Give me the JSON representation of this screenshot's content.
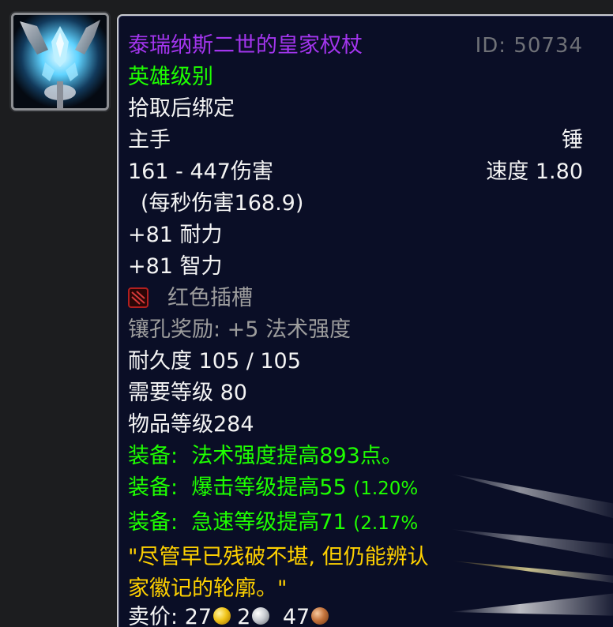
{
  "item": {
    "name": "泰瑞纳斯二世的皇家权杖",
    "id_text": "ID: 50734",
    "quality": "英雄级别",
    "bind": "拾取后绑定",
    "slot": "主手",
    "type": "锤",
    "damage": "161 - 447伤害",
    "speed": "速度 1.80",
    "dps": "(每秒伤害168.9)",
    "stat1": "+81 耐力",
    "stat2": "+81 智力",
    "socket_label": "红色插槽",
    "socket_bonus": "镶孔奖励: +5 法术强度",
    "durability": "耐久度 105 / 105",
    "req_level": "需要等级 80",
    "item_level": "物品等级284",
    "equip1_prefix": "装备:",
    "equip1_text": "法术强度提高893点。",
    "equip2_prefix": "装备:",
    "equip2_text": "爆击等级提高55",
    "equip2_pct": "(1.20%",
    "equip3_prefix": "装备:",
    "equip3_text": "急速等级提高71",
    "equip3_pct": "(2.17%",
    "flavor_line1": "\"尽管早已残破不堪, 但仍能辨认",
    "flavor_line2": "家徽记的轮廓。\"",
    "sell_label": "卖价:",
    "sell_gold": "27",
    "sell_silver": "2",
    "sell_copper": "47"
  },
  "colors": {
    "tooltip_bg": "#0a0e26",
    "epic_purple": "#a335ee",
    "uncommon_green": "#1eff00",
    "flavor_gold": "#ffd100",
    "socket_grey": "#9d9d9d"
  },
  "icons": {
    "item_icon": "ice-crystal-scepter-icon",
    "socket_icon": "red-socket-icon",
    "gold_coin": "gold-coin-icon",
    "silver_coin": "silver-coin-icon",
    "copper_coin": "copper-coin-icon"
  }
}
